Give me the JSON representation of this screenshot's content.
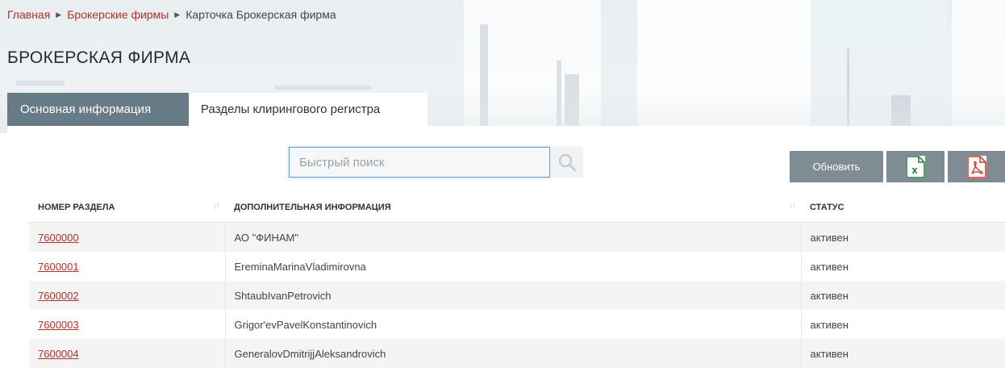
{
  "breadcrumb": {
    "home": "Главная",
    "brokers": "Брокерские фирмы",
    "current": "Карточка Брокерская фирма"
  },
  "page": {
    "title": "БРОКЕРСКАЯ ФИРМА"
  },
  "tabs": [
    {
      "label": "Основная информация",
      "active": false
    },
    {
      "label": "Разделы клирингового регистра",
      "active": true
    }
  ],
  "toolbar": {
    "search_placeholder": "Быстрый поиск",
    "refresh_label": "Обновить",
    "excel_icon": "excel-icon",
    "pdf_icon": "pdf-icon"
  },
  "table": {
    "columns": [
      "НОМЕР РАЗДЕЛА",
      "ДОПОЛНИТЕЛЬНАЯ ИНФОРМАЦИЯ",
      "СТАТУС"
    ],
    "rows": [
      {
        "number": "7600000",
        "info": "АО \"ФИНАМ\"",
        "status": "активен"
      },
      {
        "number": "7600001",
        "info": "EreminaMarinaVladimirovna",
        "status": "активен"
      },
      {
        "number": "7600002",
        "info": "ShtaubIvanPetrovich",
        "status": "активен"
      },
      {
        "number": "7600003",
        "info": "Grigor'evPavelKonstantinovich",
        "status": "активен"
      },
      {
        "number": "7600004",
        "info": "GeneralovDmitrijjAleksandrovich",
        "status": "активен"
      }
    ]
  },
  "colors": {
    "link": "#b2332c",
    "tab_inactive": "#687c87",
    "button": "#7f8c93",
    "excel": "#1e7b3c",
    "pdf": "#d9322b"
  }
}
